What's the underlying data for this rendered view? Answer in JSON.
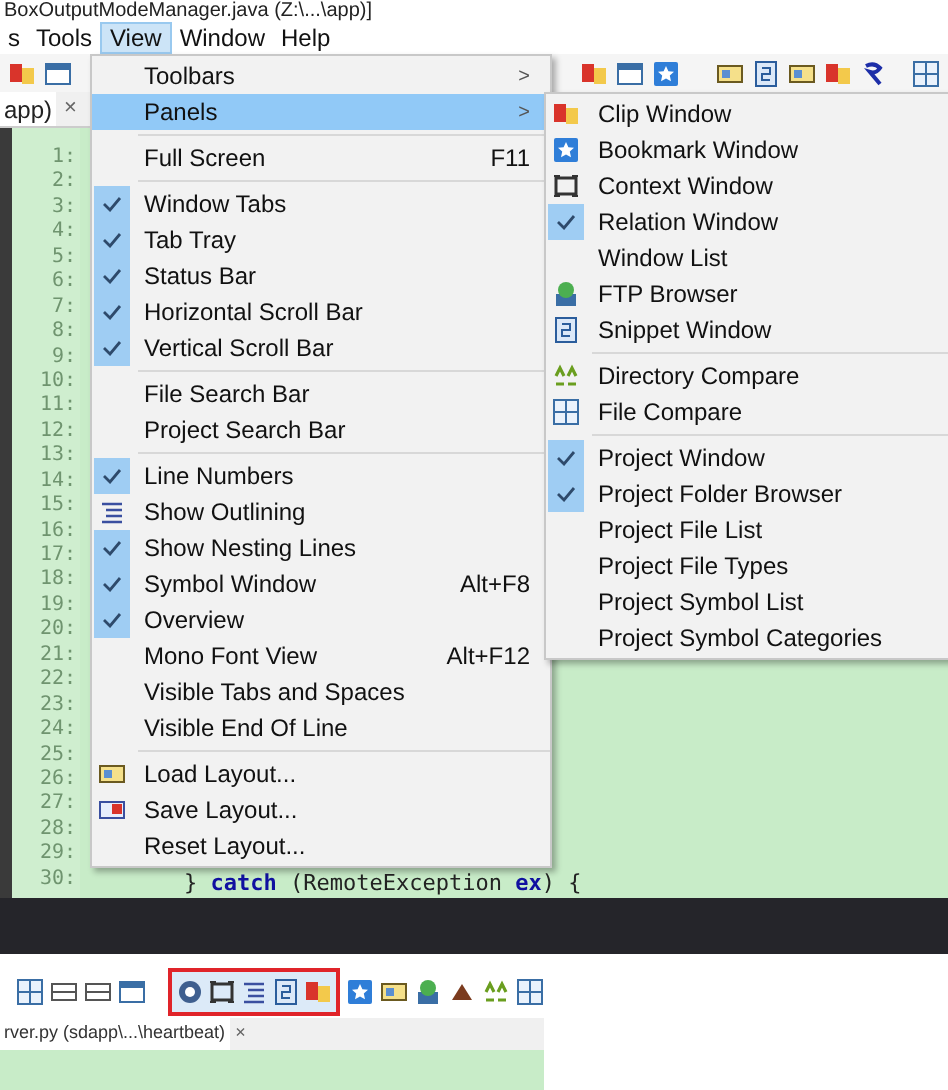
{
  "window": {
    "title": "BoxOutputModeManager.java (Z:\\...\\app)]"
  },
  "menu_bar": [
    {
      "label": "s",
      "selected": false
    },
    {
      "label": "Tools",
      "selected": false
    },
    {
      "label": "View",
      "selected": true
    },
    {
      "label": "Window",
      "selected": false
    },
    {
      "label": "Help",
      "selected": false
    }
  ],
  "editor_tab": {
    "label": "app)",
    "close": "×"
  },
  "line_numbers": [
    "1:",
    "2:",
    "3:",
    "4:",
    "5:",
    "6:",
    "7:",
    "8:",
    "9:",
    "10:",
    "11:",
    "12:",
    "13:",
    "14:",
    "15:",
    "16:",
    "17:",
    "18:",
    "19:",
    "20:",
    "21:",
    "22:",
    "23:",
    "24:",
    "25:",
    "26:",
    "27:",
    "28:",
    "29:",
    "30:"
  ],
  "code_line": "} **catch** (RemoteException **ex**) {",
  "view_menu": [
    {
      "kind": "submenu",
      "label": "Toolbars",
      "arrow": ">",
      "selected": false
    },
    {
      "kind": "submenu",
      "label": "Panels",
      "arrow": ">",
      "selected": true
    },
    {
      "kind": "separator"
    },
    {
      "kind": "check",
      "label": "Full Screen",
      "shortcut": "F11",
      "checked": false,
      "selected": false
    },
    {
      "kind": "separator"
    },
    {
      "kind": "check",
      "label": "Window Tabs",
      "checked": true,
      "selected": false
    },
    {
      "kind": "check",
      "label": "Tab Tray",
      "checked": true,
      "selected": false
    },
    {
      "kind": "check",
      "label": "Status Bar",
      "checked": true,
      "selected": false
    },
    {
      "kind": "check",
      "label": "Horizontal Scroll Bar",
      "checked": true,
      "selected": false
    },
    {
      "kind": "check",
      "label": "Vertical Scroll Bar",
      "checked": true,
      "selected": false
    },
    {
      "kind": "separator"
    },
    {
      "kind": "check",
      "label": "File Search Bar",
      "checked": false,
      "selected": false
    },
    {
      "kind": "check",
      "label": "Project Search Bar",
      "checked": false,
      "selected": false
    },
    {
      "kind": "separator"
    },
    {
      "kind": "check",
      "label": "Line Numbers",
      "checked": true,
      "selected": false
    },
    {
      "kind": "icon",
      "label": "Show Outlining",
      "selected": false
    },
    {
      "kind": "check",
      "label": "Show Nesting Lines",
      "checked": true,
      "selected": false
    },
    {
      "kind": "check",
      "label": "Symbol Window",
      "shortcut": "Alt+F8",
      "checked": true,
      "selected": false
    },
    {
      "kind": "check",
      "label": "Overview",
      "checked": true,
      "selected": false
    },
    {
      "kind": "check",
      "label": "Mono Font View",
      "shortcut": "Alt+F12",
      "checked": false,
      "selected": false
    },
    {
      "kind": "check",
      "label": "Visible Tabs and Spaces",
      "checked": false,
      "selected": false
    },
    {
      "kind": "check",
      "label": "Visible End Of Line",
      "checked": false,
      "selected": false
    },
    {
      "kind": "separator"
    },
    {
      "kind": "icon",
      "label": "Load Layout...",
      "selected": false
    },
    {
      "kind": "icon",
      "label": "Save Layout...",
      "selected": false
    },
    {
      "kind": "check",
      "label": "Reset Layout...",
      "checked": false,
      "selected": false
    }
  ],
  "panels_submenu": [
    {
      "kind": "icon",
      "label": "Clip Window",
      "selected": false
    },
    {
      "kind": "icon",
      "label": "Bookmark Window",
      "selected": false
    },
    {
      "kind": "icon",
      "label": "Context Window",
      "selected": false
    },
    {
      "kind": "check",
      "label": "Relation Window",
      "checked": true,
      "selected": false
    },
    {
      "kind": "check",
      "label": "Window List",
      "checked": false,
      "selected": false
    },
    {
      "kind": "icon",
      "label": "FTP Browser",
      "selected": false
    },
    {
      "kind": "icon",
      "label": "Snippet Window",
      "selected": false
    },
    {
      "kind": "separator"
    },
    {
      "kind": "icon",
      "label": "Directory Compare",
      "selected": false
    },
    {
      "kind": "icon",
      "label": "File Compare",
      "selected": false
    },
    {
      "kind": "separator"
    },
    {
      "kind": "check",
      "label": "Project Window",
      "checked": true,
      "selected": false
    },
    {
      "kind": "check",
      "label": "Project Folder Browser",
      "checked": true,
      "selected": false
    },
    {
      "kind": "check",
      "label": "Project File List",
      "checked": false,
      "selected": false
    },
    {
      "kind": "check",
      "label": "Project File Types",
      "checked": false,
      "selected": false
    },
    {
      "kind": "check",
      "label": "Project Symbol List",
      "checked": false,
      "selected": false
    },
    {
      "kind": "check",
      "label": "Project Symbol Categories",
      "checked": false,
      "selected": false
    }
  ],
  "bottom_window": {
    "tab": "rver.py (sdapp\\...\\heartbeat)",
    "close": "×"
  }
}
